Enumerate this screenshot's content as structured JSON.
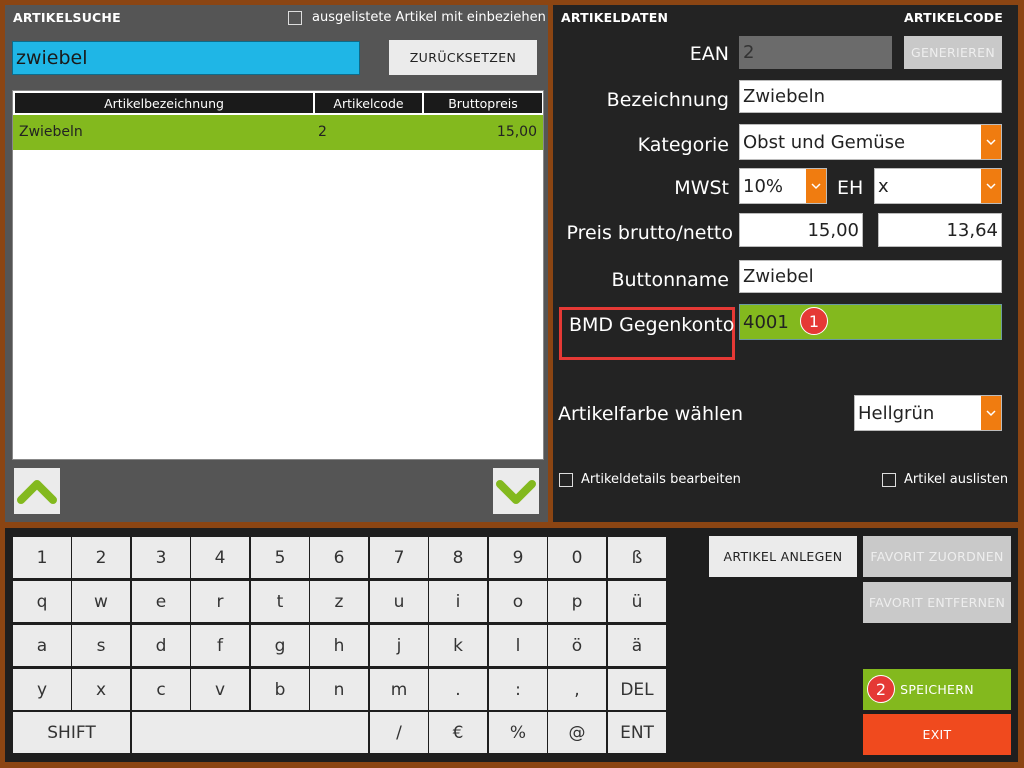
{
  "search_panel": {
    "title": "ARTIKELSUCHE",
    "include_delisted_label": "ausgelistete Artikel mit einbeziehen",
    "search_value": "zwiebel",
    "reset_label": "ZURÜCKSETZEN",
    "table": {
      "headers": [
        "Artikelbezeichnung",
        "Artikelcode",
        "Bruttopreis"
      ],
      "rows": [
        {
          "name": "Zwiebeln",
          "code": "2",
          "price": "15,00"
        }
      ]
    }
  },
  "data_panel": {
    "title": "ARTIKELDATEN",
    "title_right": "ARTIKELCODE",
    "ean_label": "EAN",
    "ean_value": "2",
    "generate_label": "GENERIEREN",
    "name_label": "Bezeichnung",
    "name_value": "Zwiebeln",
    "category_label": "Kategorie",
    "category_value": "Obst und Gemüse",
    "vat_label": "MWSt",
    "vat_value": "10%",
    "unit_label": "EH",
    "unit_value": "x",
    "price_label": "Preis brutto/netto",
    "price_gross": "15,00",
    "price_net": "13,64",
    "button_name_label": "Buttonname",
    "button_name_value": "Zwiebel",
    "bmd_label": "BMD Gegenkonto",
    "bmd_value": "4001",
    "color_label": "Artikelfarbe wählen",
    "color_value": "Hellgrün",
    "edit_details_label": "Artikeldetails bearbeiten",
    "delist_label": "Artikel auslisten"
  },
  "keyboard": {
    "row1": [
      "1",
      "2",
      "3",
      "4",
      "5",
      "6",
      "7",
      "8",
      "9",
      "0",
      "ß"
    ],
    "row2": [
      "q",
      "w",
      "e",
      "r",
      "t",
      "z",
      "u",
      "i",
      "o",
      "p",
      "ü"
    ],
    "row3": [
      "a",
      "s",
      "d",
      "f",
      "g",
      "h",
      "j",
      "k",
      "l",
      "ö",
      "ä"
    ],
    "row4": [
      "y",
      "x",
      "c",
      "v",
      "b",
      "n",
      "m",
      ".",
      ":",
      ",",
      "DEL"
    ],
    "shift": "SHIFT",
    "row5": [
      "/",
      "€",
      "%",
      "@",
      "ENT"
    ]
  },
  "actions": {
    "create": "ARTIKEL ANLEGEN",
    "assign_fav": "FAVORIT ZUORDNEN",
    "remove_fav": "FAVORIT ENTFERNEN",
    "save": "SPEICHERN",
    "exit": "EXIT"
  },
  "annotations": {
    "badge1": "1",
    "badge2": "2"
  },
  "colors": {
    "accent_green": "#83b91e",
    "accent_orange": "#f07c10",
    "exit_red": "#f04a1e",
    "search_blue": "#1fb6e6",
    "highlight_red": "#e53935"
  }
}
